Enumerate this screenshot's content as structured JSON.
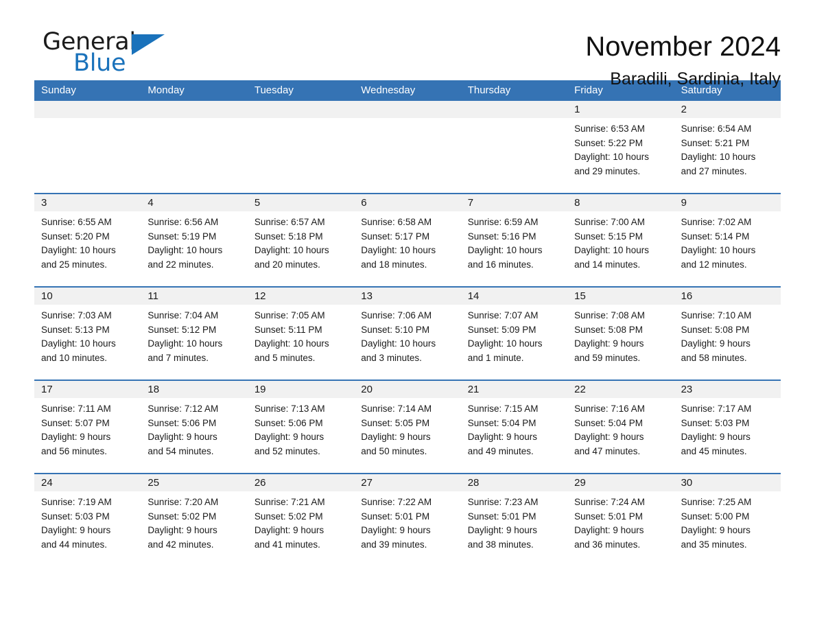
{
  "brand": {
    "name_part1": "General",
    "name_part2": "Blue",
    "accent_color": "#1a72bb",
    "flag_icon": "triangle-flag-icon"
  },
  "header": {
    "title": "November 2024",
    "subtitle": "Baradili, Sardinia, Italy"
  },
  "calendar": {
    "header_bg": "#3573b4",
    "daynum_bg": "#f1f1f1",
    "weekdays": [
      "Sunday",
      "Monday",
      "Tuesday",
      "Wednesday",
      "Thursday",
      "Friday",
      "Saturday"
    ],
    "weeks": [
      [
        {
          "day": "",
          "lines": []
        },
        {
          "day": "",
          "lines": []
        },
        {
          "day": "",
          "lines": []
        },
        {
          "day": "",
          "lines": []
        },
        {
          "day": "",
          "lines": []
        },
        {
          "day": "1",
          "lines": [
            "Sunrise: 6:53 AM",
            "Sunset: 5:22 PM",
            "Daylight: 10 hours",
            "and 29 minutes."
          ]
        },
        {
          "day": "2",
          "lines": [
            "Sunrise: 6:54 AM",
            "Sunset: 5:21 PM",
            "Daylight: 10 hours",
            "and 27 minutes."
          ]
        }
      ],
      [
        {
          "day": "3",
          "lines": [
            "Sunrise: 6:55 AM",
            "Sunset: 5:20 PM",
            "Daylight: 10 hours",
            "and 25 minutes."
          ]
        },
        {
          "day": "4",
          "lines": [
            "Sunrise: 6:56 AM",
            "Sunset: 5:19 PM",
            "Daylight: 10 hours",
            "and 22 minutes."
          ]
        },
        {
          "day": "5",
          "lines": [
            "Sunrise: 6:57 AM",
            "Sunset: 5:18 PM",
            "Daylight: 10 hours",
            "and 20 minutes."
          ]
        },
        {
          "day": "6",
          "lines": [
            "Sunrise: 6:58 AM",
            "Sunset: 5:17 PM",
            "Daylight: 10 hours",
            "and 18 minutes."
          ]
        },
        {
          "day": "7",
          "lines": [
            "Sunrise: 6:59 AM",
            "Sunset: 5:16 PM",
            "Daylight: 10 hours",
            "and 16 minutes."
          ]
        },
        {
          "day": "8",
          "lines": [
            "Sunrise: 7:00 AM",
            "Sunset: 5:15 PM",
            "Daylight: 10 hours",
            "and 14 minutes."
          ]
        },
        {
          "day": "9",
          "lines": [
            "Sunrise: 7:02 AM",
            "Sunset: 5:14 PM",
            "Daylight: 10 hours",
            "and 12 minutes."
          ]
        }
      ],
      [
        {
          "day": "10",
          "lines": [
            "Sunrise: 7:03 AM",
            "Sunset: 5:13 PM",
            "Daylight: 10 hours",
            "and 10 minutes."
          ]
        },
        {
          "day": "11",
          "lines": [
            "Sunrise: 7:04 AM",
            "Sunset: 5:12 PM",
            "Daylight: 10 hours",
            "and 7 minutes."
          ]
        },
        {
          "day": "12",
          "lines": [
            "Sunrise: 7:05 AM",
            "Sunset: 5:11 PM",
            "Daylight: 10 hours",
            "and 5 minutes."
          ]
        },
        {
          "day": "13",
          "lines": [
            "Sunrise: 7:06 AM",
            "Sunset: 5:10 PM",
            "Daylight: 10 hours",
            "and 3 minutes."
          ]
        },
        {
          "day": "14",
          "lines": [
            "Sunrise: 7:07 AM",
            "Sunset: 5:09 PM",
            "Daylight: 10 hours",
            "and 1 minute."
          ]
        },
        {
          "day": "15",
          "lines": [
            "Sunrise: 7:08 AM",
            "Sunset: 5:08 PM",
            "Daylight: 9 hours",
            "and 59 minutes."
          ]
        },
        {
          "day": "16",
          "lines": [
            "Sunrise: 7:10 AM",
            "Sunset: 5:08 PM",
            "Daylight: 9 hours",
            "and 58 minutes."
          ]
        }
      ],
      [
        {
          "day": "17",
          "lines": [
            "Sunrise: 7:11 AM",
            "Sunset: 5:07 PM",
            "Daylight: 9 hours",
            "and 56 minutes."
          ]
        },
        {
          "day": "18",
          "lines": [
            "Sunrise: 7:12 AM",
            "Sunset: 5:06 PM",
            "Daylight: 9 hours",
            "and 54 minutes."
          ]
        },
        {
          "day": "19",
          "lines": [
            "Sunrise: 7:13 AM",
            "Sunset: 5:06 PM",
            "Daylight: 9 hours",
            "and 52 minutes."
          ]
        },
        {
          "day": "20",
          "lines": [
            "Sunrise: 7:14 AM",
            "Sunset: 5:05 PM",
            "Daylight: 9 hours",
            "and 50 minutes."
          ]
        },
        {
          "day": "21",
          "lines": [
            "Sunrise: 7:15 AM",
            "Sunset: 5:04 PM",
            "Daylight: 9 hours",
            "and 49 minutes."
          ]
        },
        {
          "day": "22",
          "lines": [
            "Sunrise: 7:16 AM",
            "Sunset: 5:04 PM",
            "Daylight: 9 hours",
            "and 47 minutes."
          ]
        },
        {
          "day": "23",
          "lines": [
            "Sunrise: 7:17 AM",
            "Sunset: 5:03 PM",
            "Daylight: 9 hours",
            "and 45 minutes."
          ]
        }
      ],
      [
        {
          "day": "24",
          "lines": [
            "Sunrise: 7:19 AM",
            "Sunset: 5:03 PM",
            "Daylight: 9 hours",
            "and 44 minutes."
          ]
        },
        {
          "day": "25",
          "lines": [
            "Sunrise: 7:20 AM",
            "Sunset: 5:02 PM",
            "Daylight: 9 hours",
            "and 42 minutes."
          ]
        },
        {
          "day": "26",
          "lines": [
            "Sunrise: 7:21 AM",
            "Sunset: 5:02 PM",
            "Daylight: 9 hours",
            "and 41 minutes."
          ]
        },
        {
          "day": "27",
          "lines": [
            "Sunrise: 7:22 AM",
            "Sunset: 5:01 PM",
            "Daylight: 9 hours",
            "and 39 minutes."
          ]
        },
        {
          "day": "28",
          "lines": [
            "Sunrise: 7:23 AM",
            "Sunset: 5:01 PM",
            "Daylight: 9 hours",
            "and 38 minutes."
          ]
        },
        {
          "day": "29",
          "lines": [
            "Sunrise: 7:24 AM",
            "Sunset: 5:01 PM",
            "Daylight: 9 hours",
            "and 36 minutes."
          ]
        },
        {
          "day": "30",
          "lines": [
            "Sunrise: 7:25 AM",
            "Sunset: 5:00 PM",
            "Daylight: 9 hours",
            "and 35 minutes."
          ]
        }
      ]
    ]
  }
}
